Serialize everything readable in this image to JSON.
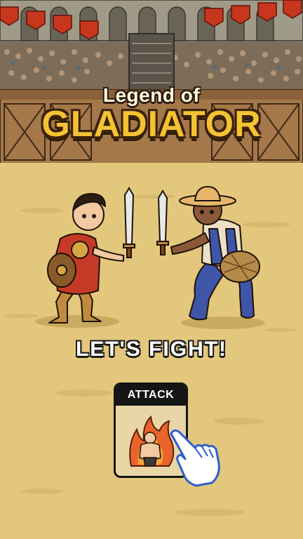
{
  "game": {
    "title_line1": "Legend of",
    "title_line2": "GLADIATOR",
    "prompt": "LET'S FIGHT!",
    "attack_card": {
      "label": "ATTACK",
      "icon": "flaming-warrior-icon"
    },
    "tutorial_hint_icon": "pointing-hand-icon"
  },
  "colors": {
    "sand": "#e3c77c",
    "title_gold": "#f4c233",
    "card_bg": "#e8d6a6",
    "card_header": "#151515",
    "banner_red": "#c8361e"
  }
}
